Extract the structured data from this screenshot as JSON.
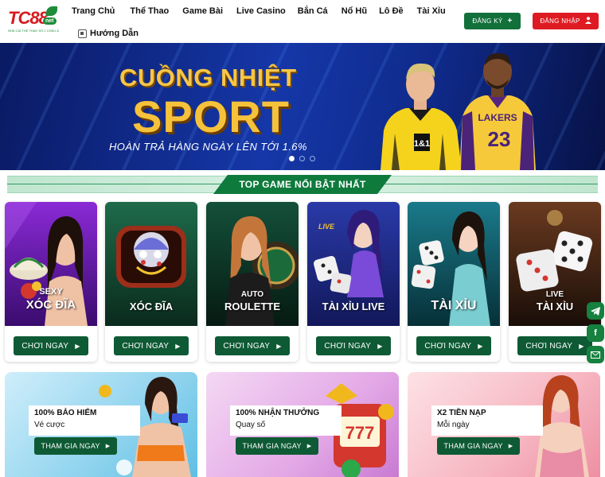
{
  "header": {
    "logo_text": "TC88",
    "logo_badge": "net",
    "logo_tagline": "NHÀ CÁI THỂ THAO SỐ 1 CHÂU Á",
    "nav": [
      "Trang Chủ",
      "Thể Thao",
      "Game Bài",
      "Live Casino",
      "Bắn Cá",
      "Nổ Hũ",
      "Lô Đề",
      "Tài Xỉu"
    ],
    "guide_label": "Hướng Dẫn",
    "register_label": "ĐĂNG KÝ",
    "login_label": "ĐĂNG NHẬP",
    "colors": {
      "register": "#12703a",
      "login": "#de1b22"
    }
  },
  "banner": {
    "line1": "CUỒNG NHIỆT",
    "line2": "SPORT",
    "line3": "HOÀN TRẢ HÀNG NGÀY LÊN TỚI 1.6%",
    "player1_number": "1&1",
    "player2_number": "23",
    "player2_team": "LAKERS",
    "slides": 3,
    "active_slide": 1
  },
  "section": {
    "title": "TOP GAME NỔI BẬT NHẤT"
  },
  "games": [
    {
      "sub": "SEXY",
      "title": "XÓC ĐĨA",
      "button": "CHƠI NGAY"
    },
    {
      "sub": "",
      "title": "XÓC ĐĨA",
      "button": "CHƠI NGAY"
    },
    {
      "sub": "AUTO",
      "title": "ROULETTE",
      "button": "CHƠI NGAY"
    },
    {
      "sub": "LIVE",
      "title": "TÀI XỈU LIVE",
      "button": "CHƠI NGAY"
    },
    {
      "sub": "",
      "title": "TÀI XỈU",
      "button": "CHƠI NGAY"
    },
    {
      "sub": "LIVE",
      "title": "TÀI XỈU",
      "button": "CHƠI NGAY"
    }
  ],
  "promos": [
    {
      "title": "100% BẢO HIỂM",
      "sub": "Vé cược",
      "button": "THAM GIA NGAY"
    },
    {
      "title": "100% NHẬN THƯỞNG",
      "sub": "Quay số",
      "button": "THAM GIA NGAY"
    },
    {
      "title": "X2 TIỀN NẠP",
      "sub": "Mỗi ngày",
      "button": "THAM GIA NGAY"
    }
  ],
  "side": [
    "telegram-icon",
    "facebook-icon",
    "mail-icon"
  ]
}
